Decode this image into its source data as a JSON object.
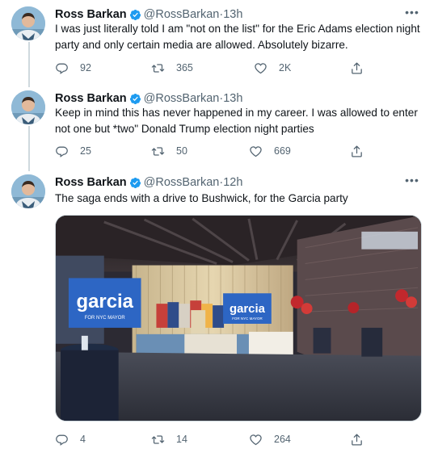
{
  "tweets": [
    {
      "name": "Ross Barkan",
      "handle": "@RossBarkan",
      "time": "13h",
      "text": "I was just literally told I am \"not on the list\" for the Eric Adams election night party and only certain media are allowed. Absolutely bizarre.",
      "replies": "92",
      "retweets": "365",
      "likes": "2K"
    },
    {
      "name": "Ross Barkan",
      "handle": "@RossBarkan",
      "time": "13h",
      "text": "Keep in mind this has never happened in my career. I was allowed to enter not one but *two\" Donald Trump election night parties",
      "replies": "25",
      "retweets": "50",
      "likes": "669"
    },
    {
      "name": "Ross Barkan",
      "handle": "@RossBarkan",
      "time": "12h",
      "text": "The saga ends with a drive to Bushwick, for the Garcia party",
      "replies": "4",
      "retweets": "14",
      "likes": "264",
      "image": {
        "sign_left": "garcia",
        "sign_left_sub": "FOR NYC MAYOR",
        "sign_right": "garcia",
        "sign_right_sub": "FOR NYC MAYOR"
      }
    }
  ],
  "separator": " · ",
  "colors": {
    "secondary": "#536471",
    "verified": "#1d9bf0",
    "thread_line": "#cfd9de"
  },
  "icons": [
    "verified-badge-icon",
    "more-icon",
    "reply-icon",
    "retweet-icon",
    "like-icon",
    "share-icon"
  ]
}
